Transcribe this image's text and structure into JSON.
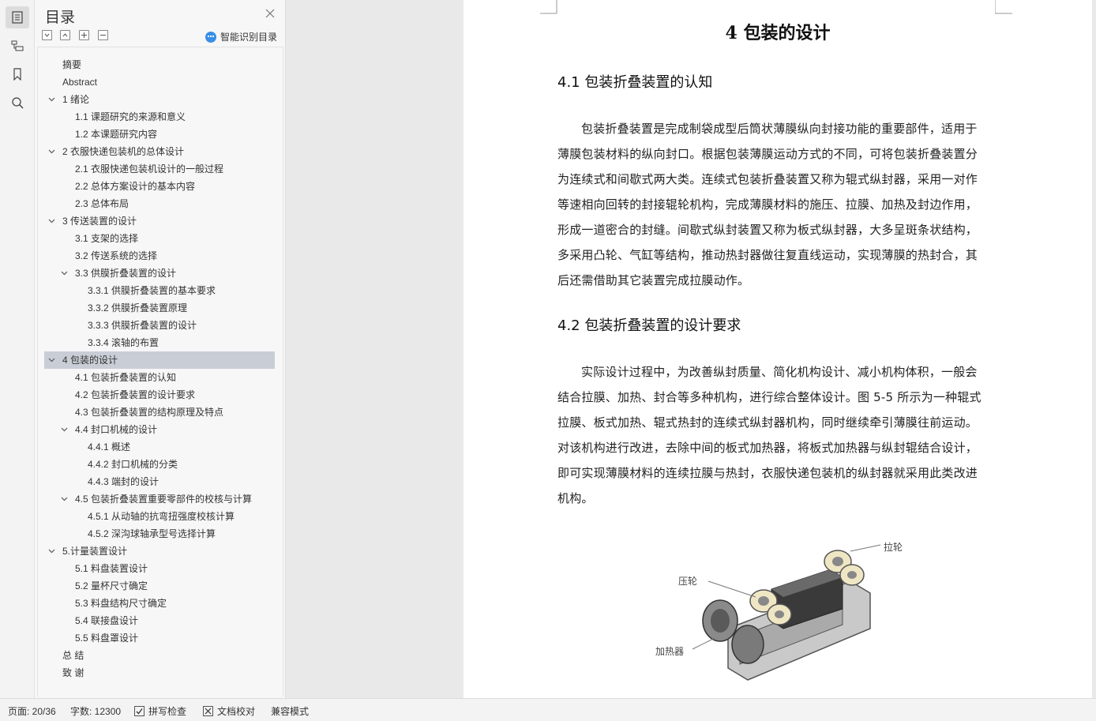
{
  "toc": {
    "title": "目录",
    "smart_label": "智能识别目录",
    "items": [
      {
        "label": "摘要",
        "level": 0,
        "chev": ""
      },
      {
        "label": "Abstract",
        "level": 0,
        "chev": ""
      },
      {
        "label": "1  绪论",
        "level": 0,
        "chev": "down"
      },
      {
        "label": "1.1 课题研究的来源和意义",
        "level": 1,
        "chev": ""
      },
      {
        "label": "1.2 本课题研究内容",
        "level": 1,
        "chev": ""
      },
      {
        "label": "2  衣服快递包装机的总体设计",
        "level": 0,
        "chev": "down"
      },
      {
        "label": "2.1 衣服快递包装机设计的一般过程",
        "level": 1,
        "chev": ""
      },
      {
        "label": "2.2  总体方案设计的基本内容",
        "level": 1,
        "chev": ""
      },
      {
        "label": "2.3 总体布局",
        "level": 1,
        "chev": ""
      },
      {
        "label": "3  传送装置的设计",
        "level": 0,
        "chev": "down"
      },
      {
        "label": "3.1 支架的选择",
        "level": 1,
        "chev": ""
      },
      {
        "label": "3.2 传送系统的选择",
        "level": 1,
        "chev": ""
      },
      {
        "label": "3.3  供膜折叠装置的设计",
        "level": 1,
        "chev": "down"
      },
      {
        "label": "3.3.1 供膜折叠装置的基本要求",
        "level": 2,
        "chev": ""
      },
      {
        "label": "3.3.2 供膜折叠装置原理",
        "level": 2,
        "chev": ""
      },
      {
        "label": "3.3.3 供膜折叠装置的设计",
        "level": 2,
        "chev": ""
      },
      {
        "label": "3.3.4 滚轴的布置",
        "level": 2,
        "chev": ""
      },
      {
        "label": "4  包装的设计",
        "level": 0,
        "chev": "down",
        "selected": true
      },
      {
        "label": "4.1 包装折叠装置的认知",
        "level": 1,
        "chev": ""
      },
      {
        "label": "4.2 包装折叠装置的设计要求",
        "level": 1,
        "chev": ""
      },
      {
        "label": "4.3 包装折叠装置的结构原理及特点",
        "level": 1,
        "chev": ""
      },
      {
        "label": "4.4 封口机械的设计",
        "level": 1,
        "chev": "down"
      },
      {
        "label": "4.4.1  概述",
        "level": 2,
        "chev": ""
      },
      {
        "label": "4.4.2  封口机械的分类",
        "level": 2,
        "chev": ""
      },
      {
        "label": "4.4.3  端封的设计",
        "level": 2,
        "chev": ""
      },
      {
        "label": "4.5  包装折叠装置重要零部件的校核与计算",
        "level": 1,
        "chev": "down"
      },
      {
        "label": "4.5.1  从动轴的抗弯扭强度校核计算",
        "level": 2,
        "chev": ""
      },
      {
        "label": "4.5.2 深沟球轴承型号选择计算",
        "level": 2,
        "chev": ""
      },
      {
        "label": "5.计量装置设计",
        "level": 0,
        "chev": "down"
      },
      {
        "label": "5.1 料盘装置设计",
        "level": 1,
        "chev": ""
      },
      {
        "label": "5.2 量杯尺寸确定",
        "level": 1,
        "chev": ""
      },
      {
        "label": "5.3 料盘结构尺寸确定",
        "level": 1,
        "chev": ""
      },
      {
        "label": "5.4 联接盘设计",
        "level": 1,
        "chev": ""
      },
      {
        "label": "5.5 料盘罩设计",
        "level": 1,
        "chev": ""
      },
      {
        "label": "总  结",
        "level": 0,
        "chev": ""
      },
      {
        "label": "致  谢",
        "level": 0,
        "chev": ""
      }
    ]
  },
  "doc": {
    "chapter_title": "4  包装的设计",
    "sec1_title": "4.1 包装折叠装置的认知",
    "sec1_lines": [
      "包装折叠装置是完成制袋成型后筒状薄膜纵向封接功能的重要部件，适用于",
      "薄膜包装材料的纵向封口。根据包装薄膜运动方式的不同，可将包装折叠装置分",
      "为连续式和间歇式两大类。连续式包装折叠装置又称为辊式纵封器，采用一对作",
      "等速相向回转的封接辊轮机构，完成薄膜材料的施压、拉膜、加热及封边作用，",
      "形成一道密合的封缝。间歇式纵封装置又称为板式纵封器，大多呈斑条状结构，",
      "多采用凸轮、气缸等结构，推动热封器做往复直线运动，实现薄膜的热封合，其",
      "后还需借助其它装置完成拉膜动作。"
    ],
    "sec2_title": "4.2 包装折叠装置的设计要求",
    "sec2_lines": [
      "实际设计过程中，为改善纵封质量、简化机构设计、减小机构体积，一般会",
      "结合拉膜、加热、封合等多种机构，进行综合整体设计。图 5-5 所示为一种辊式",
      "拉膜、板式加热、辊式热封的连续式纵封器机构，同时继续牵引薄膜往前运动。",
      "对该机构进行改进，去除中间的板式加热器，将板式加热器与纵封辊结合设计，",
      "即可实现薄膜材料的连续拉膜与热封，衣服快递包装机的纵封器就采用此类改进",
      "机构。"
    ],
    "figure_labels": {
      "pull_wheel": "拉轮",
      "press_wheel": "压轮",
      "heater": "加热器"
    }
  },
  "status": {
    "page": "页面: 20/36",
    "words": "字数: 12300",
    "spell": "拼写检查",
    "proof": "文档校对",
    "compat": "兼容模式"
  }
}
